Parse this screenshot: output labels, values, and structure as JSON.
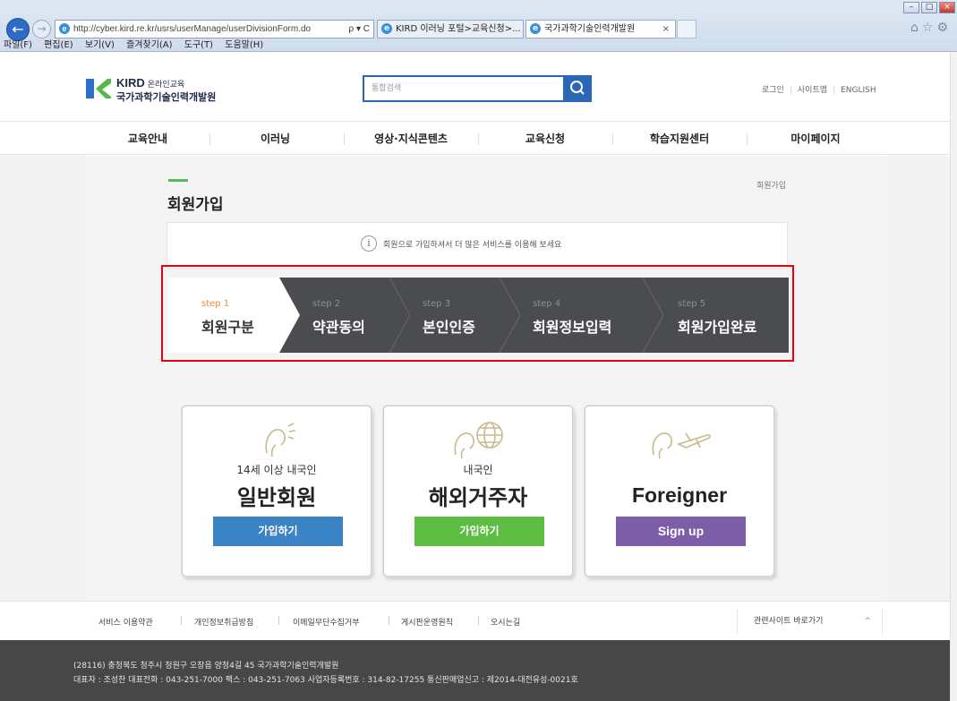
{
  "browser": {
    "url": "http://cyber.kird.re.kr/usrs/userManage/userDivisionForm.do",
    "address_tools": "ρ ▾ C",
    "tabs": [
      {
        "label": "KIRD 이러닝 포털>교육신청>..."
      },
      {
        "label": "국가과학기술인력개발원"
      }
    ],
    "tab_close": "×",
    "menu": [
      "파일(F)",
      "편집(E)",
      "보기(V)",
      "즐겨찾기(A)",
      "도구(T)",
      "도움말(H)"
    ]
  },
  "header": {
    "logo_main": "KIRD",
    "logo_sub": "온라인교육",
    "logo_org": "국가과학기술인력개발원",
    "search_placeholder": "통합검색",
    "util_links": [
      "로그인",
      "사이트맵",
      "ENGLISH"
    ]
  },
  "gnb": [
    "교육안내",
    "이러닝",
    "영상·지식콘텐츠",
    "교육신청",
    "학습지원센터",
    "마이페이지"
  ],
  "page": {
    "title": "회원가입",
    "breadcrumb": "회원가입",
    "info_icon": "i",
    "info_text": "회원으로 가입하셔서 더 많은 서비스를 이용해 보세요"
  },
  "steps": [
    {
      "num": "step 1",
      "label": "회원구분",
      "active": true
    },
    {
      "num": "step 2",
      "label": "약관동의"
    },
    {
      "num": "step 3",
      "label": "본인인증"
    },
    {
      "num": "step 4",
      "label": "회원정보입력"
    },
    {
      "num": "step 5",
      "label": "회원가입완료"
    }
  ],
  "cards": [
    {
      "subtitle": "14세 이상 내국인",
      "title": "일반회원",
      "button": "가입하기",
      "color": "#3a83c4",
      "icon": "person-icon"
    },
    {
      "subtitle": "내국인",
      "title": "해외거주자",
      "button": "가입하기",
      "color": "#5dbd42",
      "icon": "globe-person-icon"
    },
    {
      "subtitle": "",
      "title": "Foreigner",
      "button": "Sign up",
      "color": "#7b5ea7",
      "icon": "airplane-person-icon"
    }
  ],
  "footer": {
    "links": [
      "서비스 이용약관",
      "개인정보취급방침",
      "이메일무단수집거부",
      "게시판운영원칙",
      "오시는길"
    ],
    "related": "관련사이트 바로가기",
    "related_arrow": "^",
    "address": "(28116) 충청북도 청주시 청원구 오창읍 양청4길 45 국가과학기술인력개발원",
    "info": "대표자 : 조성찬   대표전화 : 043-251-7000   팩스 : 043-251-7063   사업자등록번호 : 314-82-17255   통신판매업신고 : 제2014-대전유성-0021호"
  },
  "colors": {
    "step_bar": "#4b4c50",
    "highlight": "#e60012",
    "primary": "#2c67b7",
    "footer_bg": "#474747"
  }
}
